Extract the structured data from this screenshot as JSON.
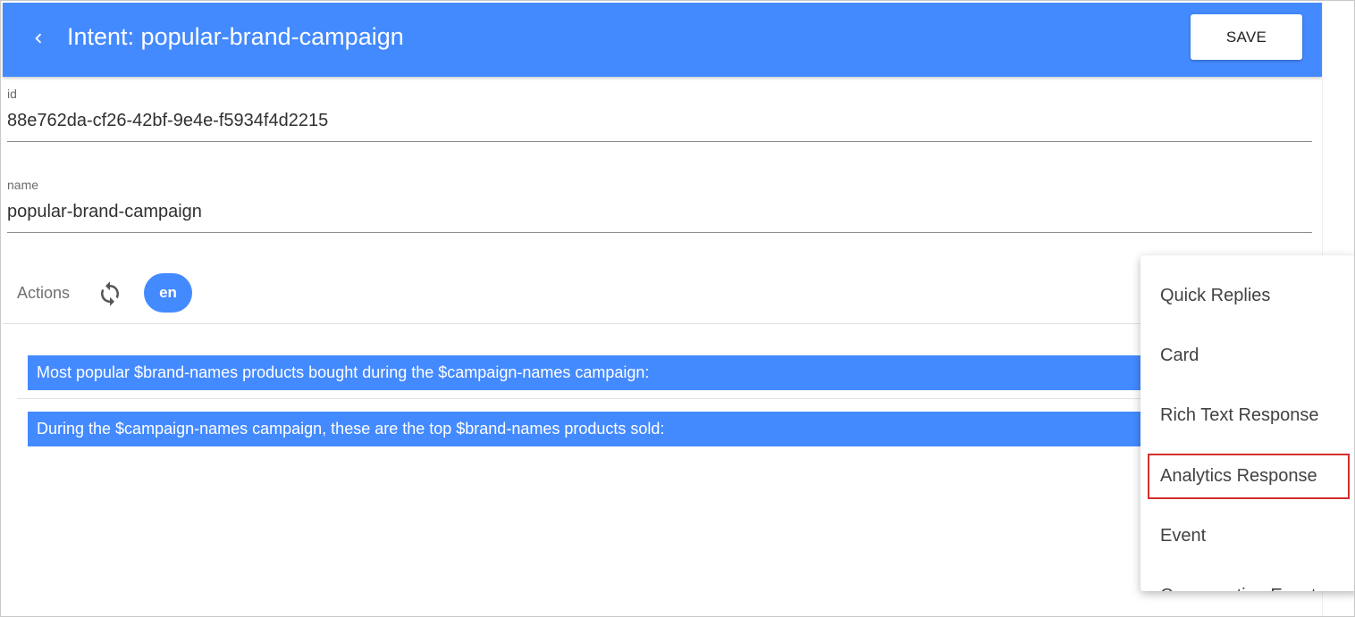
{
  "header": {
    "back_icon": "chevron-left-icon",
    "title": "Intent: popular-brand-campaign",
    "save_label": "SAVE",
    "bg_color": "#448aff"
  },
  "fields": {
    "id": {
      "label": "id",
      "value": "88e762da-cf26-42bf-9e4e-f5934f4d2215"
    },
    "name": {
      "label": "name",
      "value": "popular-brand-campaign"
    }
  },
  "actions": {
    "label": "Actions",
    "sync_icon": "sync-icon",
    "language": "en"
  },
  "responses": [
    "Most popular $brand-names products bought during the $campaign-names campaign:",
    "During the $campaign-names campaign, these are the top $brand-names products sold:"
  ],
  "menu": {
    "items": [
      "Quick Replies",
      "Card",
      "Rich Text Response",
      "Analytics Response",
      "Event",
      "Conversation Event"
    ],
    "highlighted": "Analytics Response",
    "highlight_color": "#d32f2f"
  }
}
